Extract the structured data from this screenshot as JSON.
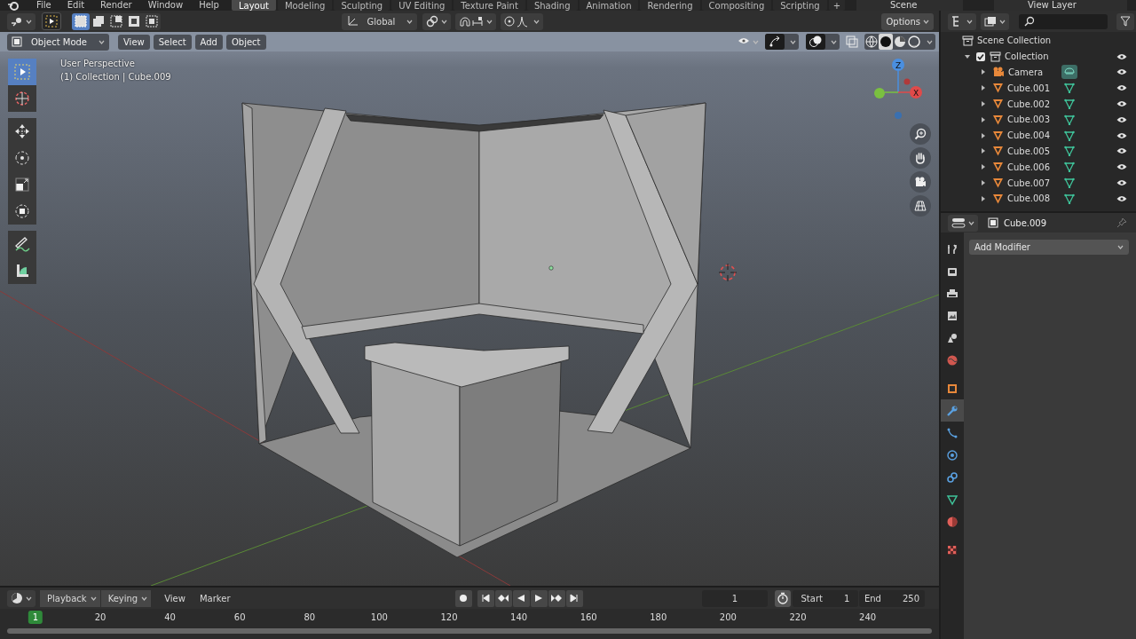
{
  "top_menu": [
    "File",
    "Edit",
    "Render",
    "Window",
    "Help"
  ],
  "workspaces": [
    {
      "label": "Layout",
      "selected": true
    },
    {
      "label": "Modeling",
      "selected": false
    },
    {
      "label": "Sculpting",
      "selected": false
    },
    {
      "label": "UV Editing",
      "selected": false
    },
    {
      "label": "Texture Paint",
      "selected": false
    },
    {
      "label": "Shading",
      "selected": false
    },
    {
      "label": "Animation",
      "selected": false
    },
    {
      "label": "Rendering",
      "selected": false
    },
    {
      "label": "Compositing",
      "selected": false
    },
    {
      "label": "Scripting",
      "selected": false
    }
  ],
  "add_workspace": "+",
  "scene_field": "Scene",
  "view_layer_field": "View Layer",
  "tool_header": {
    "selection_modes": [
      {
        "selected": true
      },
      {
        "selected": false
      },
      {
        "selected": false
      },
      {
        "selected": false
      },
      {
        "selected": false
      }
    ],
    "orientation": "Global",
    "options_button": "Options"
  },
  "viewport": {
    "mode": "Object Mode",
    "menus": [
      "View",
      "Select",
      "Add",
      "Object"
    ],
    "shading": [
      {
        "kind": "wireframe",
        "selected": false
      },
      {
        "kind": "solid",
        "selected": true
      },
      {
        "kind": "material",
        "selected": false
      },
      {
        "kind": "rendered",
        "selected": false
      }
    ],
    "overlay_text": [
      "User Perspective",
      "(1) Collection | Cube.009"
    ],
    "tools": [
      {
        "kind": "select",
        "selected": true
      },
      {
        "kind": "cursor",
        "selected": false
      },
      {
        "kind": "move",
        "selected": false
      },
      {
        "kind": "rotate",
        "selected": false
      },
      {
        "kind": "scale",
        "selected": false
      },
      {
        "kind": "transform",
        "selected": false
      },
      {
        "kind": "annotate",
        "selected": false
      },
      {
        "kind": "measure",
        "selected": false
      }
    ],
    "gizmo_labels": [
      "Z",
      "X"
    ]
  },
  "timeline": {
    "dropdowns": [
      "Playback",
      "Keying"
    ],
    "menus": [
      "View",
      "Marker"
    ],
    "current_frame": "1",
    "start_label": "Start",
    "start": "1",
    "end_label": "End",
    "end": "250",
    "ruler": [
      {
        "label": "1",
        "selected": true
      },
      {
        "label": "20",
        "selected": false
      },
      {
        "label": "40",
        "selected": false
      },
      {
        "label": "60",
        "selected": false
      },
      {
        "label": "80",
        "selected": false
      },
      {
        "label": "100",
        "selected": false
      },
      {
        "label": "120",
        "selected": false
      },
      {
        "label": "140",
        "selected": false
      },
      {
        "label": "160",
        "selected": false
      },
      {
        "label": "180",
        "selected": false
      },
      {
        "label": "200",
        "selected": false
      },
      {
        "label": "220",
        "selected": false
      },
      {
        "label": "240",
        "selected": false
      }
    ]
  },
  "outliner": {
    "tree": [
      {
        "name": "Scene Collection",
        "kind": "scene_collection",
        "children": [
          {
            "name": "Collection",
            "kind": "collection",
            "expanded": true,
            "checked": true,
            "children": [
              {
                "name": "Camera",
                "kind": "camera",
                "expanded": false
              },
              {
                "name": "Cube.001",
                "kind": "mesh",
                "expanded": false
              },
              {
                "name": "Cube.002",
                "kind": "mesh",
                "expanded": false
              },
              {
                "name": "Cube.003",
                "kind": "mesh",
                "expanded": false
              },
              {
                "name": "Cube.004",
                "kind": "mesh",
                "expanded": false
              },
              {
                "name": "Cube.005",
                "kind": "mesh",
                "expanded": false
              },
              {
                "name": "Cube.006",
                "kind": "mesh",
                "expanded": false
              },
              {
                "name": "Cube.007",
                "kind": "mesh",
                "expanded": false
              },
              {
                "name": "Cube.008",
                "kind": "mesh",
                "expanded": false
              }
            ]
          }
        ]
      }
    ]
  },
  "properties": {
    "object": "Cube.009",
    "add_modifier": "Add Modifier",
    "tabs": [
      {
        "kind": "tool",
        "selected": false
      },
      {
        "kind": "render",
        "selected": false
      },
      {
        "kind": "output",
        "selected": false
      },
      {
        "kind": "view_layer",
        "selected": false
      },
      {
        "kind": "scene",
        "selected": false
      },
      {
        "kind": "world",
        "selected": false
      },
      {
        "kind": "object",
        "selected": false
      },
      {
        "kind": "modifiers",
        "selected": true
      },
      {
        "kind": "particles",
        "selected": false
      },
      {
        "kind": "physics",
        "selected": false
      },
      {
        "kind": "constraints",
        "selected": false
      },
      {
        "kind": "data",
        "selected": false
      },
      {
        "kind": "material",
        "selected": false
      },
      {
        "kind": "texture",
        "selected": false
      }
    ]
  }
}
